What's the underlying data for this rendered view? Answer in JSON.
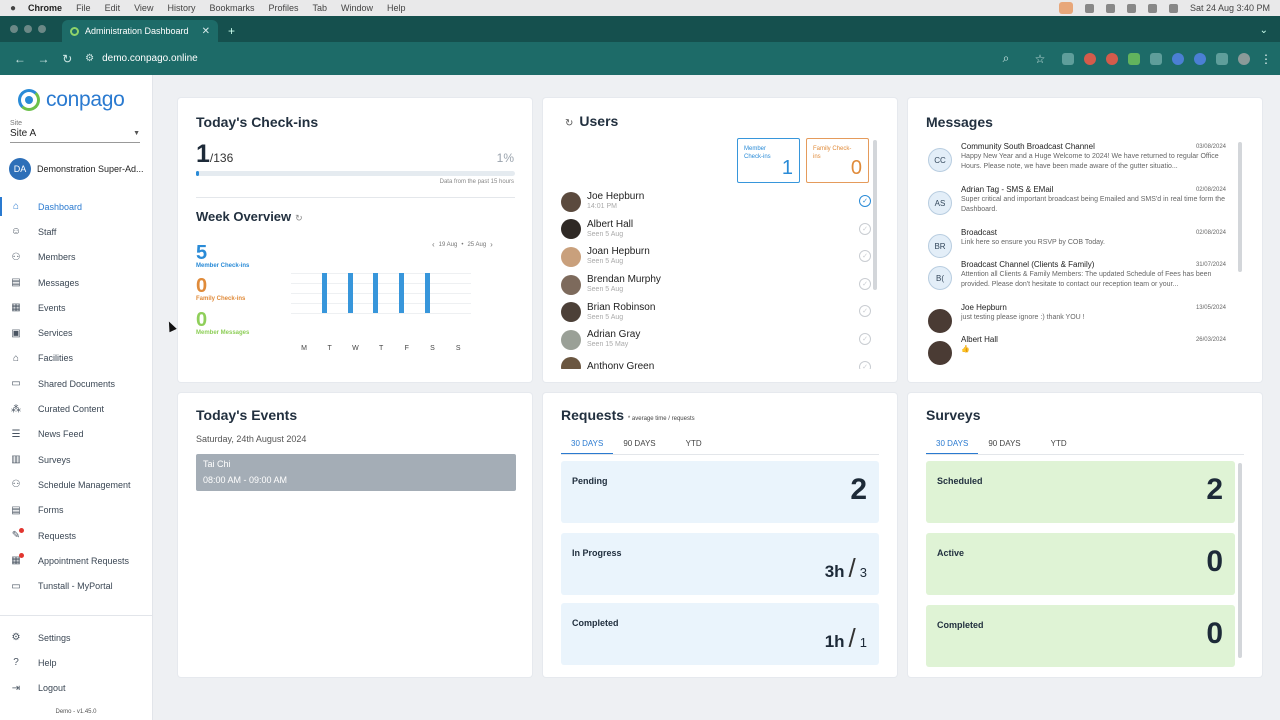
{
  "mac_menu": {
    "app": "Chrome",
    "items": [
      "File",
      "Edit",
      "View",
      "History",
      "Bookmarks",
      "Profiles",
      "Tab",
      "Window",
      "Help"
    ],
    "clock": "Sat 24 Aug  3:40 PM"
  },
  "browser": {
    "tab_title": "Administration Dashboard",
    "url": "demo.conpago.online"
  },
  "sidebar": {
    "logo": "conpago",
    "site_label": "Site",
    "site_value": "Site A",
    "user_initials": "DA",
    "user_name": "Demonstration Super-Ad...",
    "items": [
      {
        "label": "Dashboard",
        "icon": "home-icon"
      },
      {
        "label": "Staff",
        "icon": "staff-icon"
      },
      {
        "label": "Members",
        "icon": "members-icon"
      },
      {
        "label": "Messages",
        "icon": "messages-icon"
      },
      {
        "label": "Events",
        "icon": "calendar-icon"
      },
      {
        "label": "Services",
        "icon": "services-icon"
      },
      {
        "label": "Facilities",
        "icon": "facilities-icon"
      },
      {
        "label": "Shared Documents",
        "icon": "folder-icon"
      },
      {
        "label": "Curated Content",
        "icon": "content-icon"
      },
      {
        "label": "News Feed",
        "icon": "news-icon"
      },
      {
        "label": "Surveys",
        "icon": "survey-icon"
      },
      {
        "label": "Schedule Management",
        "icon": "schedule-icon"
      },
      {
        "label": "Forms",
        "icon": "forms-icon"
      },
      {
        "label": "Requests",
        "icon": "requests-icon"
      },
      {
        "label": "Appointment Requests",
        "icon": "appointment-icon"
      },
      {
        "label": "Tunstall - MyPortal",
        "icon": "portal-icon"
      }
    ],
    "bottom_items": [
      {
        "label": "Settings",
        "icon": "gear-icon"
      },
      {
        "label": "Help",
        "icon": "help-icon"
      },
      {
        "label": "Logout",
        "icon": "logout-icon"
      }
    ],
    "version": "Demo - v1.45.0"
  },
  "checkins": {
    "title": "Today's Check-ins",
    "count": "1",
    "total": "/136",
    "percent": "1%",
    "progress_fraction": 0.01,
    "note": "Data from the past 15 hours",
    "week_title": "Week Overview",
    "member_count": "5",
    "member_label": "Member Check-ins",
    "family_count": "0",
    "family_label": "Family Check-ins",
    "messages_count": "0",
    "messages_label": "Member Messages",
    "range_start": "19 Aug",
    "range_end": "25 Aug",
    "days": [
      "M",
      "T",
      "W",
      "T",
      "F",
      "S",
      "S"
    ],
    "day_values": [
      1,
      1,
      1,
      1,
      1,
      0,
      0
    ]
  },
  "users": {
    "title": "Users",
    "member_label": "Member Check-ins",
    "member_count": "1",
    "family_label": "Family Check-ins",
    "family_count": "0",
    "list": [
      {
        "name": "Joe Hepburn",
        "seen": "14:01 PM",
        "checked": true
      },
      {
        "name": "Albert Hall",
        "seen": "Seen 5 Aug",
        "checked": false
      },
      {
        "name": "Joan Hepburn",
        "seen": "Seen 5 Aug",
        "checked": false
      },
      {
        "name": "Brendan Murphy",
        "seen": "Seen 5 Aug",
        "checked": false
      },
      {
        "name": "Brian Robinson",
        "seen": "Seen 5 Aug",
        "checked": false
      },
      {
        "name": "Adrian Gray",
        "seen": "Seen 15 May",
        "checked": false
      },
      {
        "name": "Anthony Green",
        "seen": "",
        "checked": false
      }
    ]
  },
  "messages": {
    "title": "Messages",
    "list": [
      {
        "initials": "CC",
        "title": "Community South Broadcast Channel",
        "date": "03/08/2024",
        "text": "Happy New Year and a Huge Welcome to 2024! We have returned to regular Office Hours. Please note, we have been made aware of the gutter situatio..."
      },
      {
        "initials": "AS",
        "title": "Adrian Tag - SMS & EMail",
        "date": "02/08/2024",
        "text": "Super critical and important broadcast being Emailed and SMS'd in real time form the Dashboard."
      },
      {
        "initials": "BR",
        "title": "Broadcast",
        "date": "02/08/2024",
        "text": "Link here so ensure you RSVP by COB Today."
      },
      {
        "initials": "B(",
        "title": "Broadcast Channel (Clients & Family)",
        "date": "31/07/2024",
        "text": "Attention all Clients & Family Members: The updated Schedule of Fees has been provided. Please don't hesitate to contact our reception team or your..."
      },
      {
        "initials": "",
        "title": "Joe Hepburn",
        "date": "13/05/2024",
        "text": "just testing please ignore :) thank YOU !"
      },
      {
        "initials": "",
        "title": "Albert Hall",
        "date": "26/03/2024",
        "text": "👍"
      }
    ]
  },
  "events": {
    "title": "Today's Events",
    "date": "Saturday, 24th August 2024",
    "items": [
      {
        "name": "Tai Chi",
        "time": "08:00 AM - 09:00 AM"
      }
    ]
  },
  "requests": {
    "title": "Requests",
    "subtitle": "* average time / requests",
    "tabs": [
      "30 DAYS",
      "90 DAYS",
      "YTD"
    ],
    "pending_label": "Pending",
    "pending_value": "2",
    "in_progress_label": "In Progress",
    "in_progress_time": "3h",
    "in_progress_count": "3",
    "completed_label": "Completed",
    "completed_time": "1h",
    "completed_count": "1"
  },
  "surveys": {
    "title": "Surveys",
    "tabs": [
      "30 DAYS",
      "90 DAYS",
      "YTD"
    ],
    "scheduled_label": "Scheduled",
    "scheduled_value": "2",
    "active_label": "Active",
    "active_value": "0",
    "completed_label": "Completed",
    "completed_value": "0"
  },
  "colors": {
    "brand_blue": "#2a8bd7",
    "browser_teal": "#1d6b68",
    "orange": "#e08b3a",
    "green": "#8fcf5a"
  }
}
